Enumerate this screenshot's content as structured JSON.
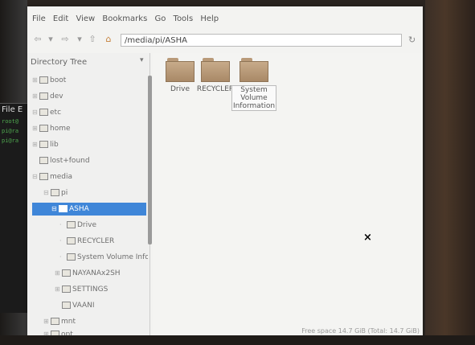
{
  "menu": [
    "File",
    "Edit",
    "View",
    "Bookmarks",
    "Go",
    "Tools",
    "Help"
  ],
  "path": "/media/pi/ASHA",
  "terminal": {
    "title": "File E",
    "lines": [
      "root@",
      "pi@ra",
      "pi@ra"
    ]
  },
  "sidebar": {
    "header": "Directory Tree",
    "items": [
      {
        "label": "boot"
      },
      {
        "label": "dev"
      },
      {
        "label": "etc"
      },
      {
        "label": "home"
      },
      {
        "label": "lib"
      },
      {
        "label": "lost+found"
      },
      {
        "label": "media"
      },
      {
        "label": "pi"
      },
      {
        "label": "ASHA"
      },
      {
        "label": "Drive"
      },
      {
        "label": "RECYCLER"
      },
      {
        "label": "System Volume Informat"
      },
      {
        "label": "NAYANAx2SH"
      },
      {
        "label": "SETTINGS"
      },
      {
        "label": "VAANI"
      },
      {
        "label": "mnt"
      },
      {
        "label": "opt"
      }
    ]
  },
  "files": [
    {
      "name": "Drive"
    },
    {
      "name": "RECYCLER"
    },
    {
      "name": "System Volume Information"
    }
  ],
  "status": "Free space 14.7 GiB (Total: 14.7 GiB)",
  "close_glyph": "×",
  "colors": {
    "selection": "#3f86d8",
    "folder": "#b99a79"
  }
}
